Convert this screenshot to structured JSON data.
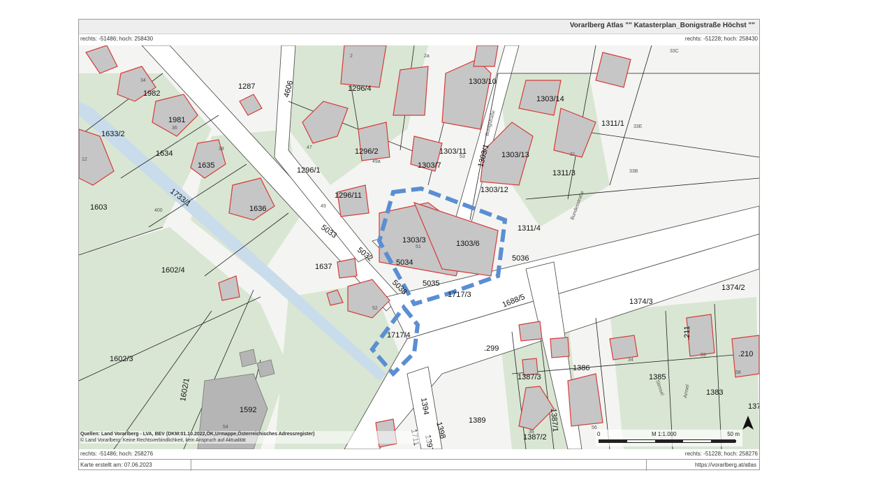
{
  "header": {
    "title": "Vorarlberg Atlas \"\" Katasterplan_Bonigstraße Höchst \"\""
  },
  "coords": {
    "top_left": "rechts: -51486; hoch: 258430",
    "top_right": "rechts: -51228; hoch: 258430",
    "bottom_left": "rechts: -51486; hoch: 258276",
    "bottom_right": "rechts: -51228; hoch: 258276"
  },
  "footer": {
    "created": "Karte erstellt am: 07.06.2023",
    "url": "https://vorarlberg.at/atlas"
  },
  "source": {
    "line1": "Quellen: Land Vorarlberg - LVA, BEV (DKM:01.10.2022,ÖK,Urmappe,Österreichisches Adressregister)",
    "line2": "© Land Vorarlberg: Keine Rechtsverbindlichkeit, kein Anspruch auf Aktualität"
  },
  "scale": {
    "zero": "0",
    "ratio": "M 1:1.000",
    "end": "50 m"
  },
  "parcels": {
    "p1287": "1287",
    "p1296_4": "1296/4",
    "p1303_10": "1303/10",
    "p1303_14": "1303/14",
    "p1311_1": "1311/1",
    "p1982": "1982",
    "p1981": "1981",
    "p1633_2": "1633/2",
    "p4606": "4606",
    "p1303_11": "1303/11",
    "p1303_1": "1303/1",
    "p1303_13": "1303/13",
    "p1296_2": "1296/2",
    "p1303_7": "1303/7",
    "p1634": "1634",
    "p1635": "1635",
    "p1296_1": "1296/1",
    "p1303_12": "1303/12",
    "p1311_3": "1311/3",
    "p1733_1": "1733/1",
    "p1296_11": "1296/11",
    "p1603": "1603",
    "p1636": "1636",
    "p1311_4": "1311/4",
    "p5033": "5033",
    "p1303_3": "1303/3",
    "p1303_6": "1303/6",
    "p5032": "5032",
    "p1602_4": "1602/4",
    "p1637": "1637",
    "p5034": "5034",
    "p5036": "5036",
    "p1374_2": "1374/2",
    "p5038": "5038",
    "p5035": "5035",
    "p1717_3": "1717/3",
    "p1688_5": "1688/5",
    "p1374_3": "1374/3",
    "p1717_4": "1717/4",
    "p299": ".299",
    "p211": ".211",
    "p210": ".210",
    "p1602_3": "1602/3",
    "p1386": "1386",
    "p1387_3": "1387/3",
    "p1385": "1385",
    "p1383": "1383",
    "p1602_1": "1602/1",
    "p1592": "1592",
    "p1394": "1394",
    "p1389": "1389",
    "p1387_1": "1387/1",
    "p1387_2": "1387/2",
    "p1398": "1398",
    "p1711": "1711",
    "p1397": "1397",
    "p137": "137"
  },
  "house_numbers": {
    "h2": "2",
    "h2a": "2a",
    "h33c": "33C",
    "h34": "34",
    "h36": "36",
    "h38": "38",
    "h47": "47",
    "h49a": "49a",
    "h53": "53",
    "h31": "31",
    "h33e": "33E",
    "h33b": "33B",
    "h12": "12",
    "h49": "49",
    "h51": "51",
    "h52": "52",
    "h400": "400",
    "h54": "54",
    "h56": "56",
    "h34b": "34",
    "h59": "59",
    "h58": "58",
    "h38b": "38"
  },
  "streets": {
    "s1": "Bonigstraße",
    "s2": "Bundesstraße",
    "s3": "Stimsel",
    "s4": "Amsel"
  },
  "colors": {
    "building_fill": "#c6c6c6",
    "building_stroke": "#d63a3a",
    "road_fill": "#ffffff",
    "green": "#d9e6d3",
    "highlight": "#5b8ed3",
    "water": "#c9dceb"
  },
  "icons": {
    "north": "north-arrow-icon"
  }
}
